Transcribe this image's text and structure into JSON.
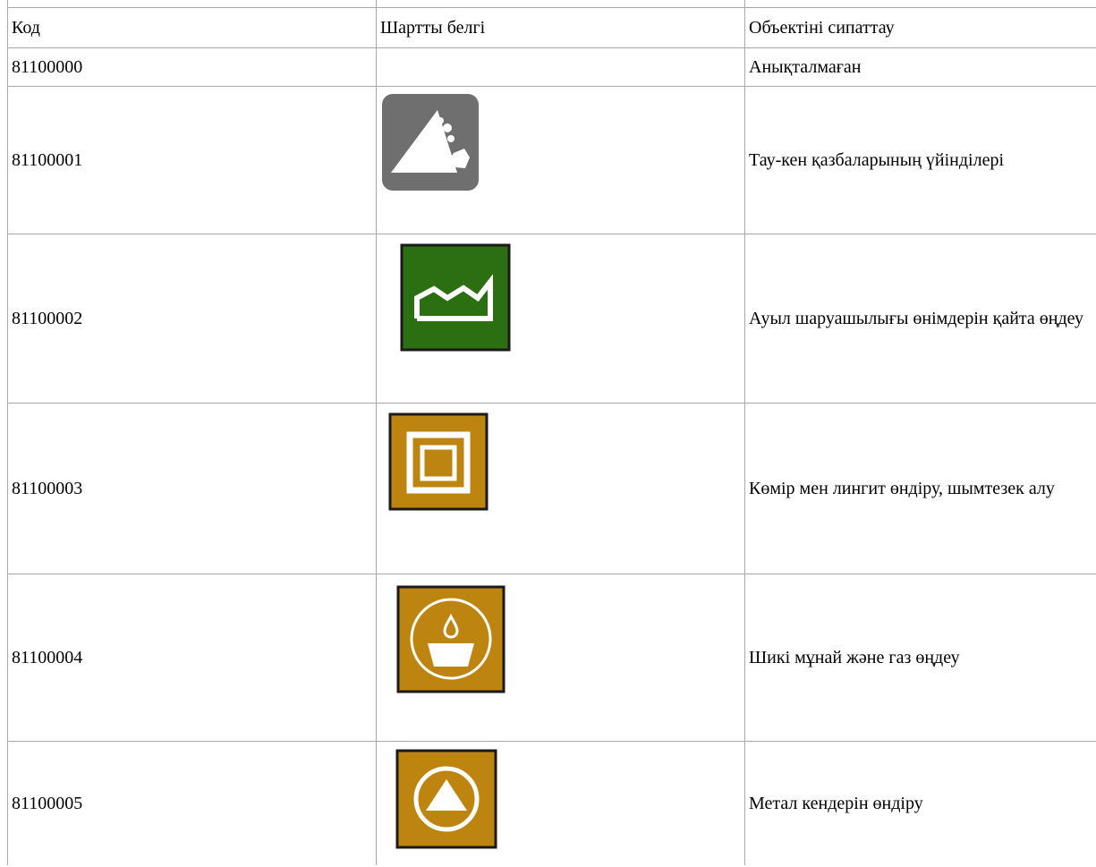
{
  "table": {
    "headers": {
      "code": "Код",
      "symbol": "Шартты белгі",
      "description": "Объектіні сипаттау"
    },
    "rows": [
      {
        "code": "81100000",
        "symbol_icon": "",
        "description": "Анықталмаған"
      },
      {
        "code": "81100001",
        "symbol_icon": "mine-dump-icon",
        "description": "Тау-кен қазбаларының үйінділері"
      },
      {
        "code": "81100002",
        "symbol_icon": "factory-icon",
        "description": "Ауыл шаруашылығы өнімдерін қайта өңдеу"
      },
      {
        "code": "81100003",
        "symbol_icon": "coal-mining-icon",
        "description": "Көмір мен лингит өндіру, шымтезек алу"
      },
      {
        "code": "81100004",
        "symbol_icon": "oil-gas-icon",
        "description": "Шикі мұнай және газ өңдеу"
      },
      {
        "code": "81100005",
        "symbol_icon": "metal-ore-icon",
        "description": "Метал кендерін өндіру"
      }
    ]
  },
  "colors": {
    "grid_line": "#a8a8a8",
    "mine_dump_gray": "#6f6f6f",
    "factory_green": "#2c6e12",
    "mining_ochre": "#bd8410",
    "icon_border": "#1a1a1a"
  }
}
